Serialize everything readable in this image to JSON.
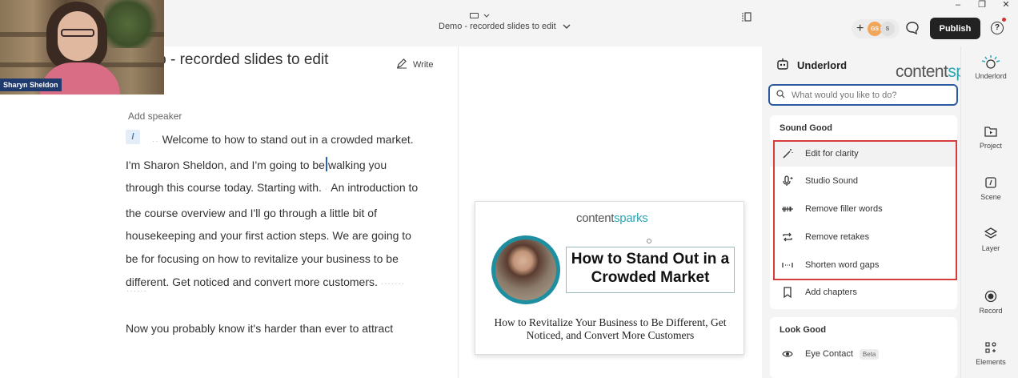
{
  "window": {
    "minimize": "–",
    "maximize": "❐",
    "close": "✕"
  },
  "header": {
    "title": "Demo - recorded slides to edit",
    "collaborators": [
      "GS",
      "S"
    ],
    "add_label": "+",
    "publish_label": "Publish",
    "help_label": "?"
  },
  "video": {
    "name": "Sharyn Sheldon"
  },
  "editor": {
    "write_label": "Write",
    "heading": "Demo - recorded slides to edit",
    "add_speaker": "Add speaker",
    "slash": "/",
    "transcript_part1": "Welcome to how to stand out in a crowded market. I'm Sharon Sheldon, and I'm going to be",
    "transcript_part2": "walking you through this course today. Starting with.",
    "transcript_part3": "An introduction to the course overview and I'll go through a little bit of housekeeping and your first action steps. We are going to be for focusing on how to revitalize your business to be different. Get noticed and convert more customers.",
    "dots1": "··",
    "dots2": "·",
    "dots3": "·······",
    "dots4": "······",
    "next_line": "Now you probably know it's harder than ever to attract"
  },
  "slide": {
    "logo_a": "content",
    "logo_b": "sparks",
    "title": "How to Stand Out in a Crowded Market",
    "subtitle": "How to Revitalize Your Business to Be Different, Get Noticed, and Convert More Customers"
  },
  "underlord": {
    "title": "Underlord",
    "logo_a": "content",
    "logo_b": "sparks",
    "search_placeholder": "What would you like to do?",
    "section1": "Sound Good",
    "items": [
      {
        "label": "Edit for clarity",
        "icon": "wand-icon"
      },
      {
        "label": "Studio Sound",
        "icon": "mic-sparkle-icon"
      },
      {
        "label": "Remove filler words",
        "icon": "strikethrough-icon"
      },
      {
        "label": "Remove retakes",
        "icon": "repeat-icon"
      },
      {
        "label": "Shorten word gaps",
        "icon": "gap-icon"
      },
      {
        "label": "Add chapters",
        "icon": "bookmark-icon"
      }
    ],
    "section2": "Look Good",
    "items2": [
      {
        "label": "Eye Contact",
        "badge": "Beta",
        "icon": "eye-icon"
      }
    ]
  },
  "rail": [
    {
      "label": "Underlord",
      "icon": "robot-icon"
    },
    {
      "label": "Project",
      "icon": "folder-play-icon"
    },
    {
      "label": "Scene",
      "icon": "scene-icon"
    },
    {
      "label": "Layer",
      "icon": "layers-icon"
    },
    {
      "label": "Record",
      "icon": "record-icon"
    },
    {
      "label": "Elements",
      "icon": "elements-icon"
    }
  ],
  "colors": {
    "accent": "#2c5aa0",
    "highlight_box": "#d63c3c",
    "publish_bg": "#222222",
    "brand_teal": "#2aa6b5"
  }
}
